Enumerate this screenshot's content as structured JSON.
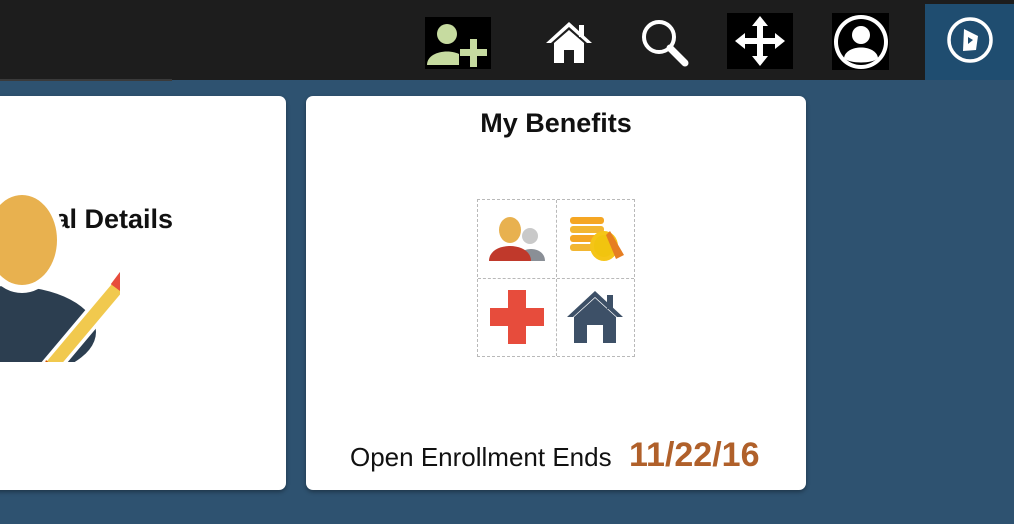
{
  "topbar": {
    "icons": {
      "add_user": "add-user-icon",
      "home": "home-icon",
      "search": "search-icon",
      "move": "move-arrows-icon",
      "profile": "user-profile-icon",
      "navbar": "compass-icon"
    },
    "colors": {
      "bar": "#1d1d1d",
      "nav_button": "#1f4d70",
      "add_user_fill": "#c6dba0"
    }
  },
  "tiles": {
    "personal": {
      "title": "Personal Details",
      "icon": "person-edit-icon"
    },
    "benefits": {
      "title": "My Benefits",
      "icons": [
        "dependents-icon",
        "coins-icon",
        "health-cross-icon",
        "house-icon"
      ],
      "footer_text": "Open Enrollment Ends",
      "footer_date": "11/22/16",
      "date_color": "#b0602a"
    }
  },
  "page": {
    "background": "#2e5270"
  }
}
